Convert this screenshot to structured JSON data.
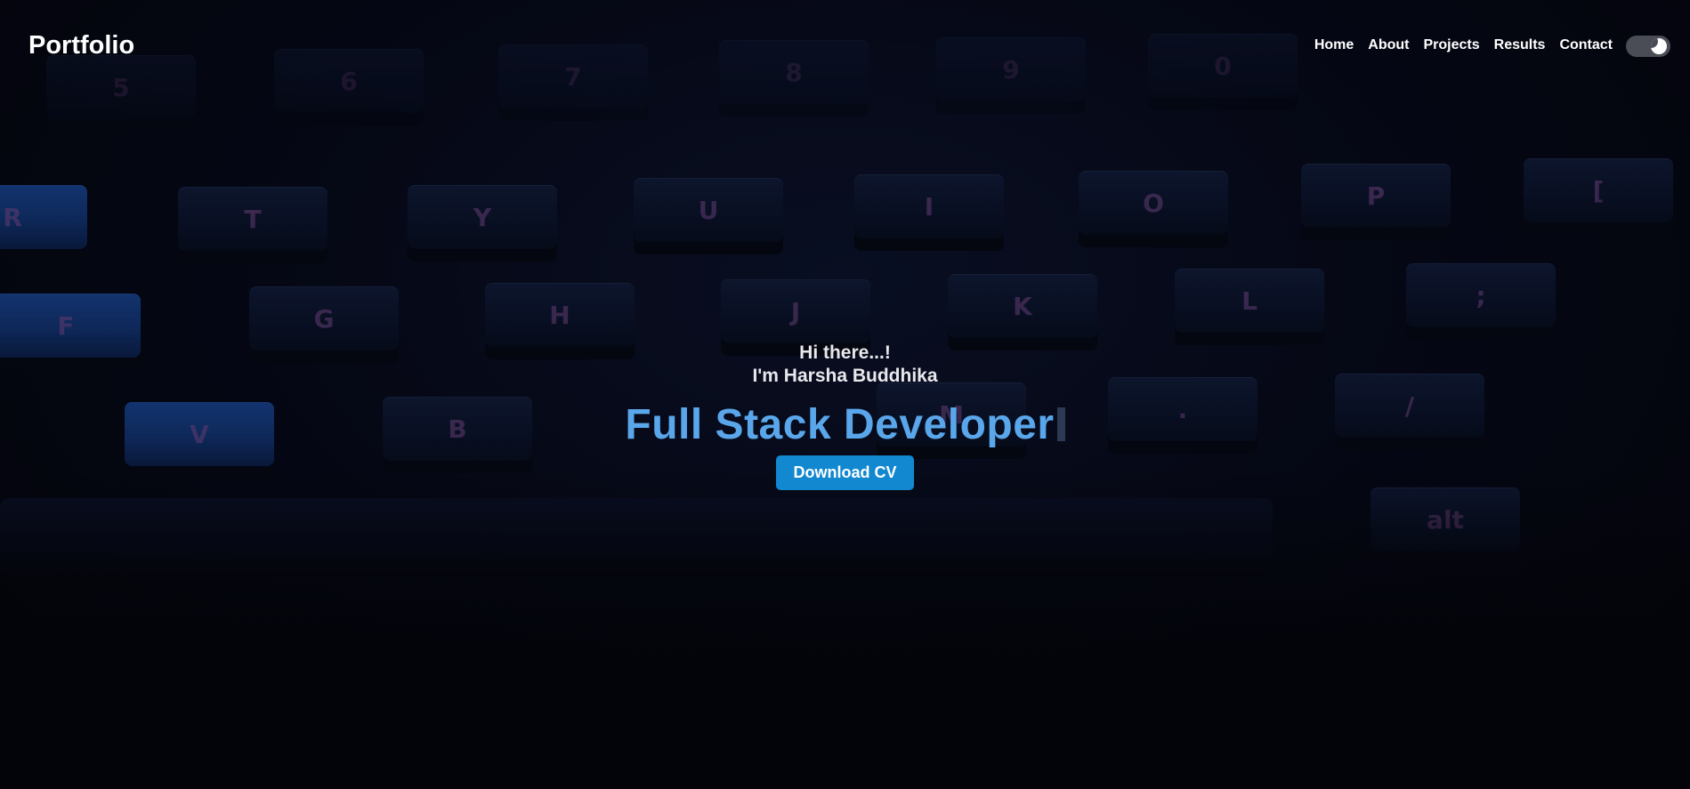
{
  "navbar": {
    "brand": "Portfolio",
    "links": [
      "Home",
      "About",
      "Projects",
      "Results",
      "Contact"
    ],
    "theme_toggle_icon": "moon-toggle-icon"
  },
  "hero": {
    "greeting": "Hi there...!",
    "name_line": "I'm Harsha Buddhika",
    "role": "Full Stack Developer",
    "cv_button": "Download CV"
  },
  "background": {
    "key_labels": [
      "5",
      "6",
      "7",
      "8",
      "9",
      "0",
      "R",
      "T",
      "Y",
      "U",
      "I",
      "O",
      "P",
      "[",
      "F",
      "G",
      "H",
      "J",
      "K",
      "L",
      ";",
      "V",
      "B",
      "M",
      ".",
      "/",
      "alt"
    ]
  },
  "colors": {
    "accent": "#5aa6ea",
    "button": "#1288d0",
    "text": "#ffffff"
  }
}
